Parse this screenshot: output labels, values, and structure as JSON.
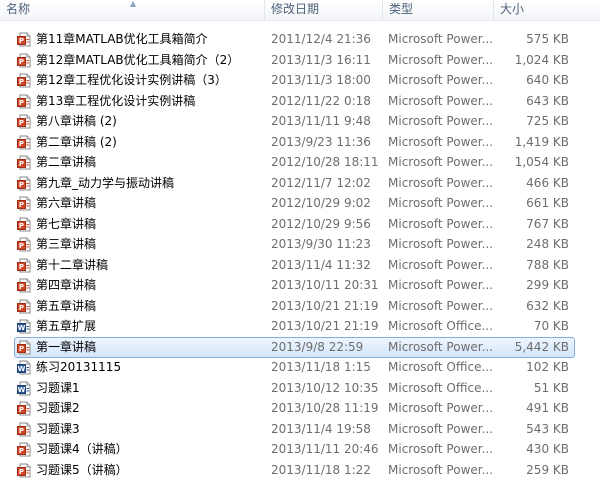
{
  "columns": {
    "name": "名称",
    "date": "修改日期",
    "type": "类型",
    "size": "大小"
  },
  "files": [
    {
      "name": "第11章MATLAB优化工具箱简介",
      "date": "2011/12/4 21:36",
      "type": "Microsoft Power...",
      "size": "575 KB",
      "icon": "powerpoint-icon"
    },
    {
      "name": "第12章MATLAB优化工具箱简介（2）",
      "date": "2013/11/3 16:11",
      "type": "Microsoft Power...",
      "size": "1,024 KB",
      "icon": "powerpoint-icon"
    },
    {
      "name": "第12章工程优化设计实例讲稿（3）",
      "date": "2013/11/3 18:00",
      "type": "Microsoft Power...",
      "size": "640 KB",
      "icon": "powerpoint-icon"
    },
    {
      "name": "第13章工程优化设计实例讲稿",
      "date": "2012/11/22 0:18",
      "type": "Microsoft Power...",
      "size": "643 KB",
      "icon": "powerpoint-icon"
    },
    {
      "name": "第八章讲稿 (2)",
      "date": "2013/11/11 9:48",
      "type": "Microsoft Power...",
      "size": "725 KB",
      "icon": "powerpoint-icon"
    },
    {
      "name": "第二章讲稿 (2)",
      "date": "2013/9/23 11:36",
      "type": "Microsoft Power...",
      "size": "1,419 KB",
      "icon": "powerpoint-icon"
    },
    {
      "name": "第二章讲稿",
      "date": "2012/10/28 18:11",
      "type": "Microsoft Power...",
      "size": "1,054 KB",
      "icon": "powerpoint-icon"
    },
    {
      "name": "第九章_动力学与振动讲稿",
      "date": "2012/11/7 12:02",
      "type": "Microsoft Power...",
      "size": "466 KB",
      "icon": "powerpoint-icon"
    },
    {
      "name": "第六章讲稿",
      "date": "2012/10/29 9:02",
      "type": "Microsoft Power...",
      "size": "661 KB",
      "icon": "powerpoint-icon"
    },
    {
      "name": "第七章讲稿",
      "date": "2012/10/29 9:56",
      "type": "Microsoft Power...",
      "size": "767 KB",
      "icon": "powerpoint-icon"
    },
    {
      "name": "第三章讲稿",
      "date": "2013/9/30 11:23",
      "type": "Microsoft Power...",
      "size": "248 KB",
      "icon": "powerpoint-icon"
    },
    {
      "name": "第十二章讲稿",
      "date": "2013/11/4 11:32",
      "type": "Microsoft Power...",
      "size": "788 KB",
      "icon": "powerpoint-icon"
    },
    {
      "name": "第四章讲稿",
      "date": "2013/10/11 20:31",
      "type": "Microsoft Power...",
      "size": "299 KB",
      "icon": "powerpoint-icon"
    },
    {
      "name": "第五章讲稿",
      "date": "2013/10/21 21:19",
      "type": "Microsoft Power...",
      "size": "632 KB",
      "icon": "powerpoint-icon"
    },
    {
      "name": "第五章扩展",
      "date": "2013/10/21 21:19",
      "type": "Microsoft Office...",
      "size": "70 KB",
      "icon": "word-icon"
    },
    {
      "name": "第一章讲稿",
      "date": "2013/9/8 22:59",
      "type": "Microsoft Power...",
      "size": "5,442 KB",
      "icon": "powerpoint-icon",
      "selected": true
    },
    {
      "name": "练习20131115",
      "date": "2013/11/18 1:15",
      "type": "Microsoft Office...",
      "size": "102 KB",
      "icon": "word-icon"
    },
    {
      "name": "习题课1",
      "date": "2013/10/12 10:35",
      "type": "Microsoft Office...",
      "size": "51 KB",
      "icon": "word-icon"
    },
    {
      "name": "习题课2",
      "date": "2013/10/28 11:19",
      "type": "Microsoft Power...",
      "size": "491 KB",
      "icon": "powerpoint-icon"
    },
    {
      "name": "习题课3",
      "date": "2013/11/4 19:58",
      "type": "Microsoft Power...",
      "size": "543 KB",
      "icon": "powerpoint-icon"
    },
    {
      "name": "习题课4（讲稿）",
      "date": "2013/11/11 20:46",
      "type": "Microsoft Power...",
      "size": "430 KB",
      "icon": "powerpoint-icon"
    },
    {
      "name": "习题课5（讲稿）",
      "date": "2013/11/18 1:22",
      "type": "Microsoft Power...",
      "size": "259 KB",
      "icon": "powerpoint-icon"
    }
  ]
}
